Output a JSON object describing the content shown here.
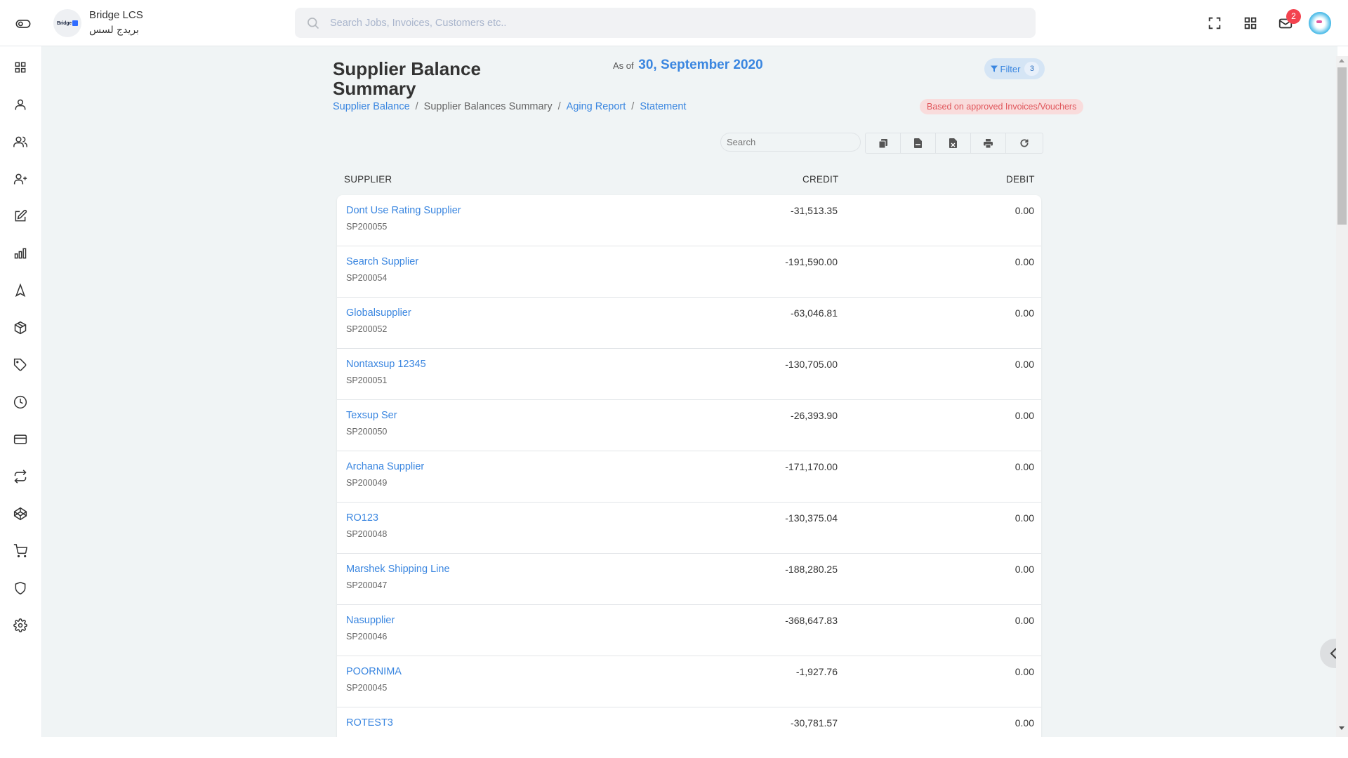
{
  "header": {
    "toggle_icon": "toggle-sidebar-icon",
    "brand": {
      "name": "Bridge LCS",
      "name_ar": "بريدج لسس",
      "logo_text": "Bridge"
    },
    "search_placeholder": "Search Jobs, Invoices, Customers etc..",
    "icons": [
      "fullscreen-icon",
      "apps-grid-icon",
      "mail-icon"
    ],
    "notification_count": "2",
    "accent_color": "#3a86e0",
    "badge_color": "#f3434f"
  },
  "sidebar": {
    "items": [
      {
        "name": "dashboard",
        "icon": "grid-icon"
      },
      {
        "name": "user",
        "icon": "user-icon"
      },
      {
        "name": "users",
        "icon": "users-icon"
      },
      {
        "name": "add-user",
        "icon": "user-plus-icon"
      },
      {
        "name": "edit",
        "icon": "edit-icon"
      },
      {
        "name": "reports",
        "icon": "bar-chart-icon"
      },
      {
        "name": "navigation",
        "icon": "navigation-icon"
      },
      {
        "name": "package",
        "icon": "box-icon"
      },
      {
        "name": "tags",
        "icon": "tag-icon"
      },
      {
        "name": "history",
        "icon": "clock-icon"
      },
      {
        "name": "payments",
        "icon": "credit-card-icon"
      },
      {
        "name": "transfers",
        "icon": "repeat-icon"
      },
      {
        "name": "modules",
        "icon": "codepen-icon"
      },
      {
        "name": "purchases",
        "icon": "cart-icon"
      },
      {
        "name": "security",
        "icon": "shield-icon"
      },
      {
        "name": "settings",
        "icon": "gear-icon"
      }
    ]
  },
  "page": {
    "title": "Supplier Balance Summary",
    "as_of_label": "As of",
    "as_of_date": "30, September 2020",
    "filter_label": "Filter",
    "filter_count": "3",
    "basis_note": "Based on approved Invoices/Vouchers",
    "breadcrumb": [
      {
        "label": "Supplier Balance",
        "link": true
      },
      {
        "label": "Supplier Balances Summary",
        "link": false
      },
      {
        "label": "Aging Report",
        "link": true
      },
      {
        "label": "Statement",
        "link": true
      }
    ],
    "table_search_placeholder": "Search",
    "tools": [
      "copy-icon",
      "csv-icon",
      "excel-icon",
      "print-icon",
      "refresh-icon"
    ]
  },
  "table": {
    "columns": [
      "SUPPLIER",
      "CREDIT",
      "DEBIT"
    ],
    "rows": [
      {
        "name": "Dont Use Rating Supplier",
        "code": "SP200055",
        "credit": "-31,513.35",
        "debit": "0.00"
      },
      {
        "name": "Search Supplier",
        "code": "SP200054",
        "credit": "-191,590.00",
        "debit": "0.00"
      },
      {
        "name": "Globalsupplier",
        "code": "SP200052",
        "credit": "-63,046.81",
        "debit": "0.00"
      },
      {
        "name": "Nontaxsup 12345",
        "code": "SP200051",
        "credit": "-130,705.00",
        "debit": "0.00"
      },
      {
        "name": "Texsup Ser",
        "code": "SP200050",
        "credit": "-26,393.90",
        "debit": "0.00"
      },
      {
        "name": "Archana Supplier",
        "code": "SP200049",
        "credit": "-171,170.00",
        "debit": "0.00"
      },
      {
        "name": "RO123",
        "code": "SP200048",
        "credit": "-130,375.04",
        "debit": "0.00"
      },
      {
        "name": "Marshek Shipping Line",
        "code": "SP200047",
        "credit": "-188,280.25",
        "debit": "0.00"
      },
      {
        "name": "Nasupplier",
        "code": "SP200046",
        "credit": "-368,647.83",
        "debit": "0.00"
      },
      {
        "name": "POORNIMA",
        "code": "SP200045",
        "credit": "-1,927.76",
        "debit": "0.00"
      },
      {
        "name": "ROTEST3",
        "code": "",
        "credit": "-30,781.57",
        "debit": "0.00"
      }
    ]
  }
}
